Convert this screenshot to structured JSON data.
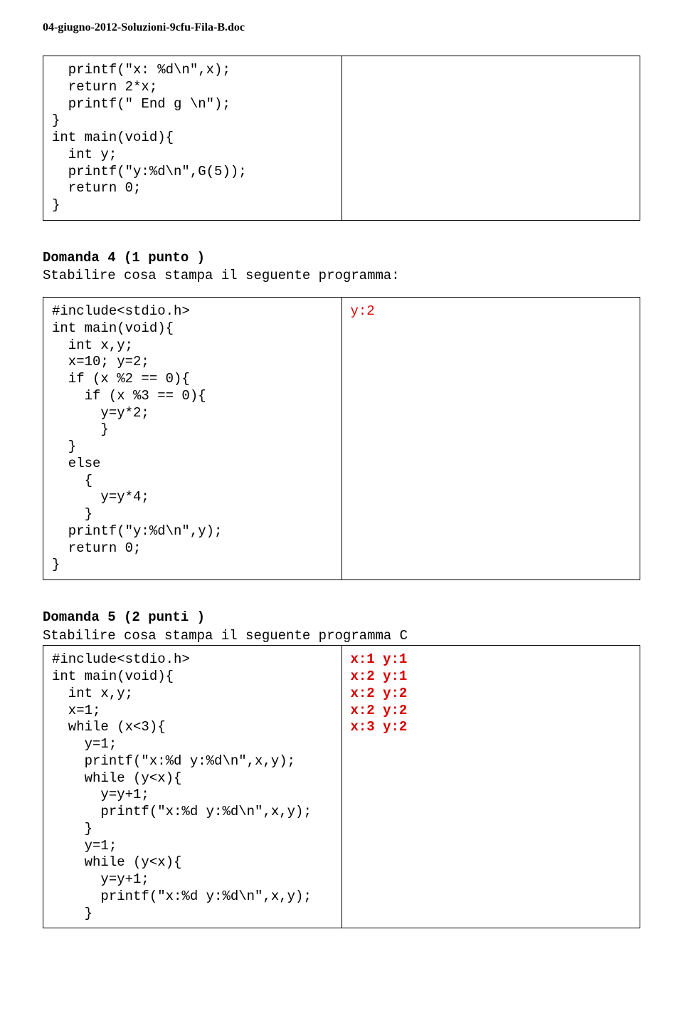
{
  "header": "04-giugno-2012-Soluzioni-9cfu-Fila-B.doc",
  "block1": {
    "code_left": "  printf(\"x: %d\\n\",x);\n  return 2*x;\n  printf(\" End g \\n\");\n}\nint main(void){\n  int y;\n  printf(\"y:%d\\n\",G(5));\n  return 0;\n}",
    "code_right": ""
  },
  "domanda4": {
    "title_bold": "Domanda 4 (1 punto )",
    "title_rest": "Stabilire cosa stampa il seguente programma:",
    "code_left": "#include<stdio.h>\nint main(void){\n  int x,y;\n  x=10; y=2;\n  if (x %2 == 0){\n    if (x %3 == 0){\n      y=y*2;\n      }\n  }\n  else\n    {\n      y=y*4;\n    }\n  printf(\"y:%d\\n\",y);\n  return 0;\n}",
    "code_right": "y:2"
  },
  "domanda5": {
    "title_bold": "Domanda 5 (2 punti )",
    "title_rest": "Stabilire cosa stampa il seguente programma C",
    "code_left": "#include<stdio.h>\nint main(void){\n  int x,y;\n  x=1;\n  while (x<3){\n    y=1;\n    printf(\"x:%d y:%d\\n\",x,y);\n    while (y<x){\n      y=y+1;\n      printf(\"x:%d y:%d\\n\",x,y);\n    }\n    y=1;\n    while (y<x){\n      y=y+1;\n      printf(\"x:%d y:%d\\n\",x,y);\n    }",
    "code_right": "x:1 y:1\nx:2 y:1\nx:2 y:2\nx:2 y:2\nx:3 y:2"
  }
}
